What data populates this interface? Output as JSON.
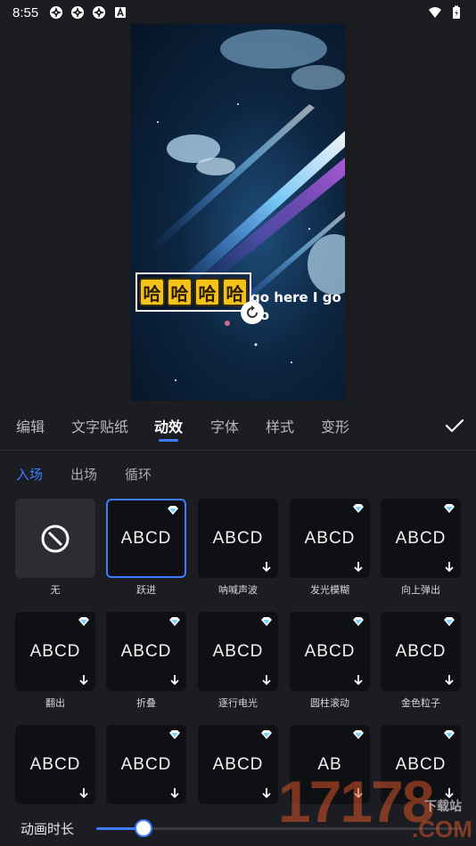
{
  "status_bar": {
    "time": "8:55",
    "left_icons": [
      "aperture-icon",
      "aperture-icon",
      "aperture-icon",
      "a-badge-icon"
    ],
    "right_icons": [
      "wifi-icon",
      "battery-icon"
    ]
  },
  "preview": {
    "sticker_chars": [
      "哈",
      "哈",
      "哈",
      "哈"
    ],
    "overlay_text": "go here I go go",
    "accent": "#f3c31a"
  },
  "main_tabs": [
    {
      "label": "编辑"
    },
    {
      "label": "文字贴纸"
    },
    {
      "label": "动效",
      "active": true
    },
    {
      "label": "字体"
    },
    {
      "label": "样式"
    },
    {
      "label": "变形"
    }
  ],
  "sub_tabs": [
    {
      "label": "入场",
      "active": true
    },
    {
      "label": "出场"
    },
    {
      "label": "循环"
    }
  ],
  "effects": [
    {
      "label": "无",
      "type": "none"
    },
    {
      "label": "跃进",
      "text": "ABCD",
      "selected": true,
      "vip": true
    },
    {
      "label": "呐喊声波",
      "text": "ABCD",
      "download": true
    },
    {
      "label": "发光模糊",
      "text": "ABCD",
      "vip": true,
      "download": true
    },
    {
      "label": "向上弹出",
      "text": "ABCD",
      "vip": true,
      "download": true
    },
    {
      "label": "翻出",
      "text": "ABCD",
      "vip": true,
      "download": true
    },
    {
      "label": "折叠",
      "text": "ABCD",
      "vip": true,
      "download": true
    },
    {
      "label": "逐行电光",
      "text": "ABCD",
      "vip": true,
      "download": true
    },
    {
      "label": "圆柱滚动",
      "text": "ABCD",
      "vip": true,
      "download": true
    },
    {
      "label": "金色粒子",
      "text": "ABCD",
      "vip": true,
      "download": true
    },
    {
      "label": "",
      "text": "ABCD",
      "download": true
    },
    {
      "label": "",
      "text": "ABCD",
      "vip": true,
      "download": true
    },
    {
      "label": "",
      "text": "ABCD",
      "vip": true,
      "download": true
    },
    {
      "label": "",
      "text": "AB",
      "vip": true,
      "download": true
    },
    {
      "label": "",
      "text": "ABCD",
      "vip": true,
      "download": true
    }
  ],
  "duration": {
    "label": "动画时长",
    "value_fraction": 0.13
  },
  "watermark": {
    "number": "17178",
    "sub": "下载站",
    "com": ".COM"
  },
  "colors": {
    "accent": "#3d7bff",
    "panel_bg": "#1c1d22"
  }
}
